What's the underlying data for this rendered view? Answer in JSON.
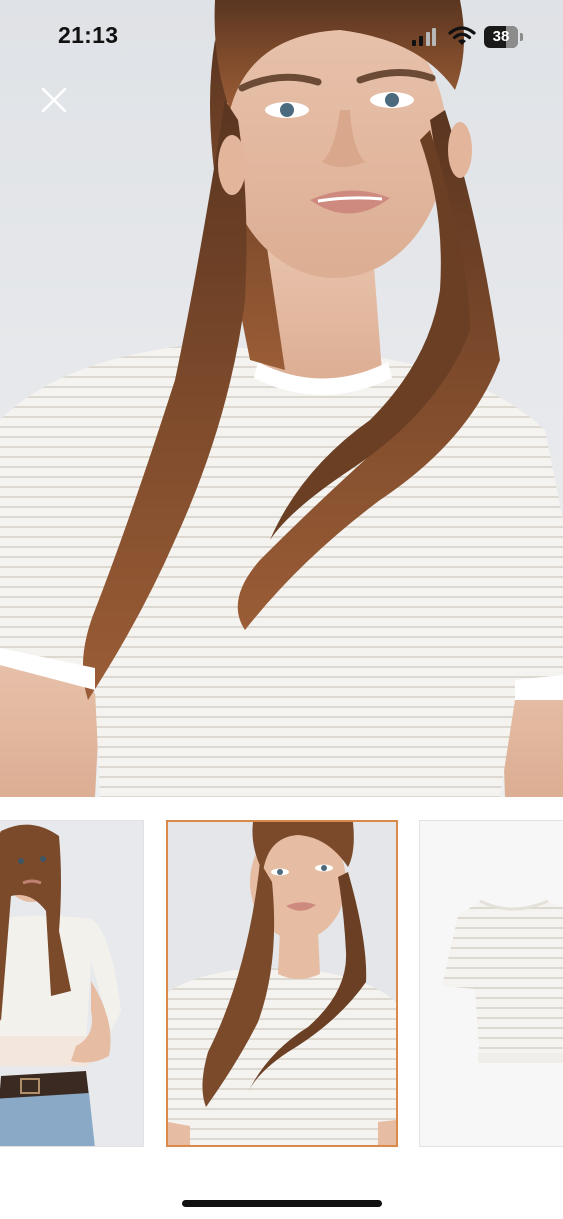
{
  "status_bar": {
    "time": "21:13",
    "battery_level": "38",
    "icons": [
      "signal-icon",
      "wifi-icon",
      "battery-icon"
    ]
  },
  "viewer": {
    "close_icon": "close-icon",
    "selected_thumbnail_index": 1,
    "colors": {
      "selected_border": "#d9894a",
      "background": "#ffffff",
      "garment": "#f4f2ee",
      "hair": "#7a4a2a"
    }
  },
  "thumbnails": [
    {
      "label": "model-front-view"
    },
    {
      "label": "model-closeup-view"
    },
    {
      "label": "product-flat-view"
    }
  ]
}
